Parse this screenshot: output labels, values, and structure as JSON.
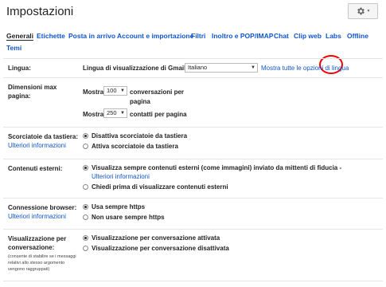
{
  "header": {
    "title": "Impostazioni"
  },
  "tabs": [
    {
      "label": "Generali",
      "active": true
    },
    {
      "label": "Etichette"
    },
    {
      "label": "Posta in arrivo"
    },
    {
      "label": "Account e importazione"
    },
    {
      "label": "Filtri"
    },
    {
      "label": "Inoltro e POP/IMAP"
    },
    {
      "label": "Chat"
    },
    {
      "label": "Clip web"
    },
    {
      "label": "Labs",
      "highlighted": true
    },
    {
      "label": "Offline"
    },
    {
      "label": "Temi"
    }
  ],
  "language": {
    "label": "Lingua:",
    "field_label": "Lingua di visualizzazione di Gmail:",
    "selected": "Italiano",
    "link": "Mostra tutte le opzioni di lingua"
  },
  "page_size": {
    "label": "Dimensioni max pagina:",
    "show": "Mostra",
    "conversations_value": "100",
    "conversations_suffix": "conversazioni per pagina",
    "contacts_value": "250",
    "contacts_suffix": "contatti per pagina"
  },
  "shortcuts": {
    "label": "Scorciatoie da tastiera:",
    "more": "Ulteriori informazioni",
    "options": [
      "Disattiva scorciatoie da tastiera",
      "Attiva scorciatoie da tastiera"
    ],
    "selected": 0
  },
  "external": {
    "label": "Contenuti esterni:",
    "options": [
      "Visualizza sempre contenuti esterni (come immagini) inviato da mittenti di fiducia -",
      "Chiedi prima di visualizzare contenuti esterni"
    ],
    "more": "Ulteriori informazioni",
    "selected": 0
  },
  "browser": {
    "label": "Connessione browser:",
    "more": "Ulteriori informazioni",
    "options": [
      "Usa sempre https",
      "Non usare sempre https"
    ],
    "selected": 0
  },
  "conversation_view": {
    "label": "Visualizzazione per conversazione:",
    "note": "(consente di stabilire se i messaggi relativi allo stesso argomento vengono raggruppati)",
    "options": [
      "Visualizzazione per conversazione attivata",
      "Visualizzazione per conversazione disattivata"
    ],
    "selected": 0
  },
  "icons": {
    "settings": "gear-icon",
    "dropdown": "chevron-down-icon"
  }
}
